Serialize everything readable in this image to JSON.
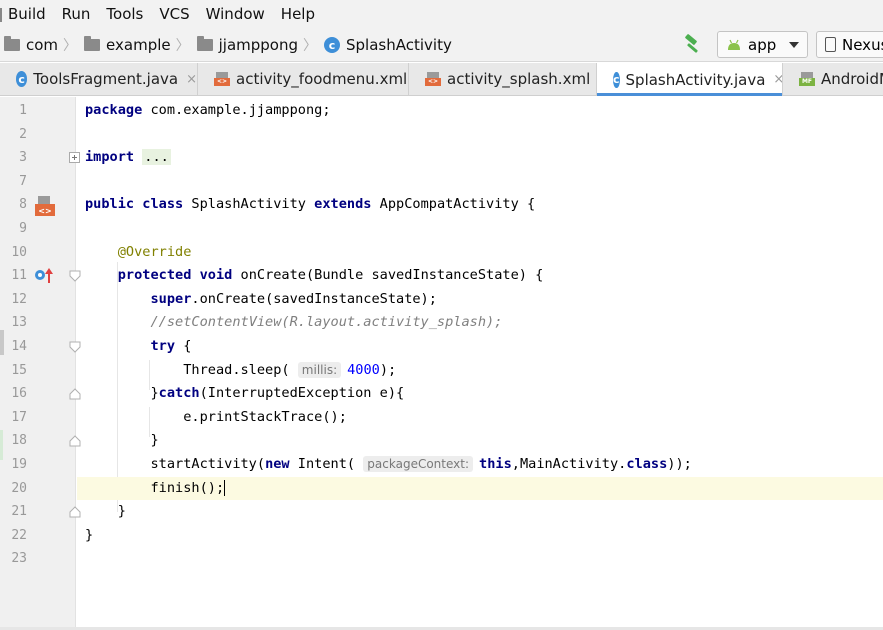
{
  "menu": [
    "Build",
    "Run",
    "Tools",
    "VCS",
    "Window",
    "Help"
  ],
  "breadcrumbs": {
    "items": [
      "com",
      "example",
      "jjamppong",
      "SplashActivity"
    ]
  },
  "toolbar": {
    "run_config": "app",
    "device": "Nexus"
  },
  "tabs": [
    {
      "label": "ToolsFragment.java",
      "icon": "class-icon",
      "close": "×",
      "active": false
    },
    {
      "label": "activity_foodmenu.xml",
      "icon": "xml-file-icon",
      "close": "×",
      "active": false
    },
    {
      "label": "activity_splash.xml",
      "icon": "xml-file-icon",
      "close": "×",
      "active": false
    },
    {
      "label": "SplashActivity.java",
      "icon": "class-icon",
      "close": "×",
      "active": true
    },
    {
      "label": "AndroidManifest.xml",
      "icon": "manifest-file-icon",
      "close": "",
      "active": false
    }
  ],
  "editor": {
    "current_line": 20,
    "lines": [
      {
        "n": "1",
        "tokens": [
          [
            "kw",
            "package"
          ],
          [
            "t",
            " com.example.jjamppong;"
          ]
        ]
      },
      {
        "n": "2",
        "tokens": []
      },
      {
        "n": "3",
        "tokens": [
          [
            "kw",
            "import"
          ],
          [
            "t",
            " "
          ],
          [
            "fold",
            "..."
          ]
        ]
      },
      {
        "n": "7",
        "tokens": []
      },
      {
        "n": "8",
        "tokens": [
          [
            "kw",
            "public class"
          ],
          [
            "t",
            " SplashActivity "
          ],
          [
            "kw",
            "extends"
          ],
          [
            "t",
            " AppCompatActivity {"
          ]
        ]
      },
      {
        "n": "9",
        "tokens": []
      },
      {
        "n": "10",
        "tokens": [
          [
            "t",
            "    "
          ],
          [
            "an",
            "@Override"
          ]
        ]
      },
      {
        "n": "11",
        "tokens": [
          [
            "t",
            "    "
          ],
          [
            "kw",
            "protected void"
          ],
          [
            "t",
            " onCreate(Bundle savedInstanceState) {"
          ]
        ]
      },
      {
        "n": "12",
        "tokens": [
          [
            "t",
            "        "
          ],
          [
            "kw",
            "super"
          ],
          [
            "t",
            ".onCreate(savedInstanceState);"
          ]
        ]
      },
      {
        "n": "13",
        "tokens": [
          [
            "t",
            "        "
          ],
          [
            "cm",
            "//setContentView(R.layout.activity_splash);"
          ]
        ]
      },
      {
        "n": "14",
        "tokens": [
          [
            "t",
            "        "
          ],
          [
            "kw",
            "try"
          ],
          [
            "t",
            " {"
          ]
        ]
      },
      {
        "n": "15",
        "tokens": [
          [
            "t",
            "            Thread.sleep( "
          ],
          [
            "hint",
            "millis:"
          ],
          [
            "num",
            "4000"
          ],
          [
            "t",
            ");"
          ]
        ]
      },
      {
        "n": "16",
        "tokens": [
          [
            "t",
            "        }"
          ],
          [
            "kw",
            "catch"
          ],
          [
            "t",
            "(InterruptedException e){"
          ]
        ]
      },
      {
        "n": "17",
        "tokens": [
          [
            "t",
            "            e.printStackTrace();"
          ]
        ]
      },
      {
        "n": "18",
        "tokens": [
          [
            "t",
            "        }"
          ]
        ]
      },
      {
        "n": "19",
        "tokens": [
          [
            "t",
            "        startActivity("
          ],
          [
            "kw",
            "new"
          ],
          [
            "t",
            " Intent( "
          ],
          [
            "hint",
            "packageContext:"
          ],
          [
            "kw",
            "this"
          ],
          [
            "t",
            ",MainActivity."
          ],
          [
            "kw",
            "class"
          ],
          [
            "t",
            "));"
          ]
        ]
      },
      {
        "n": "20",
        "tokens": [
          [
            "t",
            "        finish();"
          ],
          [
            "caret",
            ""
          ]
        ]
      },
      {
        "n": "21",
        "tokens": [
          [
            "t",
            "    }"
          ]
        ]
      },
      {
        "n": "22",
        "tokens": [
          [
            "t",
            "}"
          ]
        ]
      },
      {
        "n": "23",
        "tokens": []
      }
    ]
  },
  "colors": {
    "keyword": "#000080",
    "comment": "#808080",
    "annotation": "#808000",
    "number": "#0000ff",
    "active_tab_underline": "#4a8fd8",
    "current_line": "#fcfae1"
  }
}
